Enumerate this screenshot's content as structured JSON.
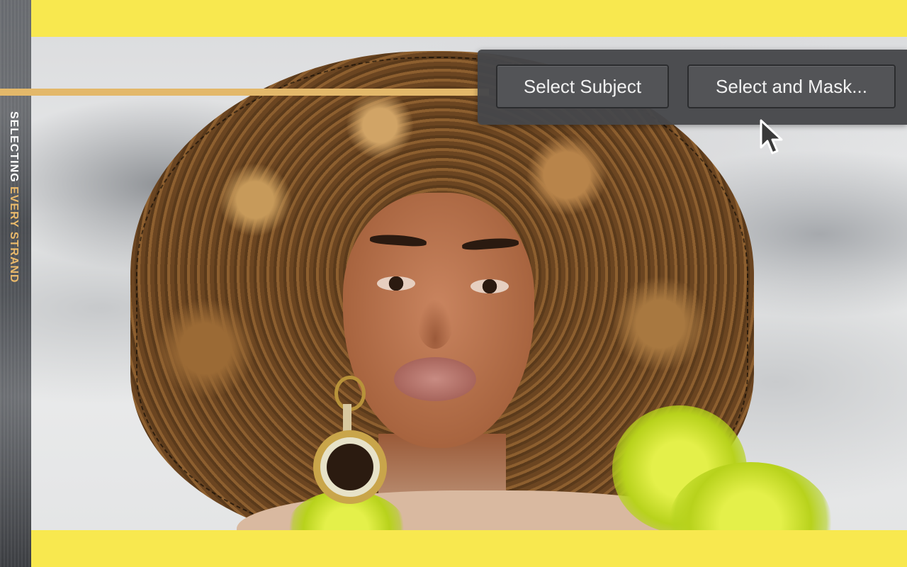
{
  "sidebar": {
    "title_part1": "SELECTING ",
    "title_part2": "EVERY STRAND"
  },
  "options_bar": {
    "select_subject_label": "Select Subject",
    "select_and_mask_label": "Select and Mask..."
  },
  "colors": {
    "band_yellow": "#f8e84f",
    "gold_accent": "#e3b86a",
    "sidebar_gray": "#4a4d52",
    "panel_gray": "#46474a"
  },
  "icons": {
    "cursor": "arrow-cursor-icon"
  }
}
